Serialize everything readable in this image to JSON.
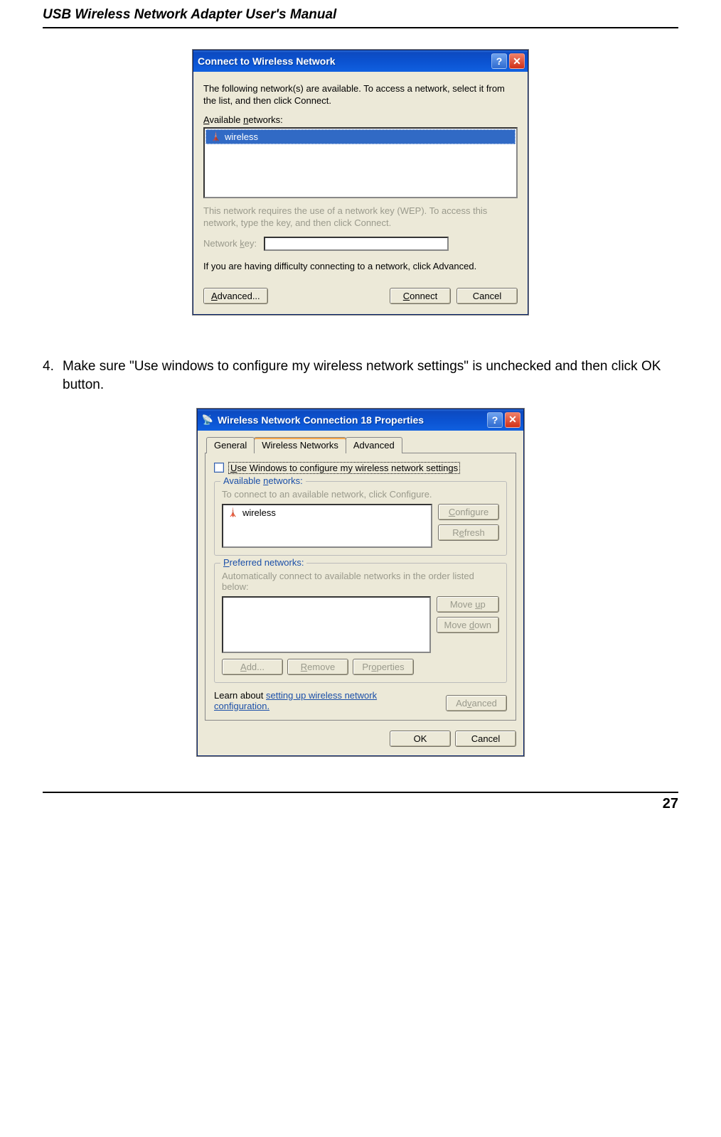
{
  "document": {
    "header": "USB Wireless Network Adapter User's Manual",
    "page_number": "27",
    "step_number": "4.",
    "step_text": "Make sure \"Use windows to configure my wireless network settings\" is unchecked and then click OK button."
  },
  "dialog1": {
    "title": "Connect to Wireless Network",
    "intro": "The following network(s) are available. To access a network, select it from the list, and then click Connect.",
    "available_label": "Available networks:",
    "list_item": "wireless",
    "wep_note": "This network requires the use of a network key (WEP). To access this network, type the key, and then click Connect.",
    "key_label": "Network key:",
    "difficulty_text": "If you are having difficulty connecting to a network, click Advanced.",
    "buttons": {
      "advanced": "Advanced...",
      "connect": "Connect",
      "cancel": "Cancel"
    }
  },
  "dialog2": {
    "title": "Wireless Network Connection 18 Properties",
    "tabs": {
      "general": "General",
      "wireless": "Wireless Networks",
      "advanced": "Advanced"
    },
    "checkbox_label": "Use Windows to configure my wireless network settings",
    "group_available": {
      "title": "Available networks:",
      "hint": "To connect to an available network, click Configure.",
      "item": "wireless",
      "configure": "Configure",
      "refresh": "Refresh"
    },
    "group_preferred": {
      "title": "Preferred networks:",
      "hint": "Automatically connect to available networks in the order listed below:",
      "move_up": "Move up",
      "move_down": "Move down",
      "add": "Add...",
      "remove": "Remove",
      "properties": "Properties"
    },
    "learn_text_prefix": "Learn about ",
    "learn_link": "setting up wireless network configuration.",
    "advanced_btn": "Advanced",
    "ok": "OK",
    "cancel": "Cancel"
  }
}
